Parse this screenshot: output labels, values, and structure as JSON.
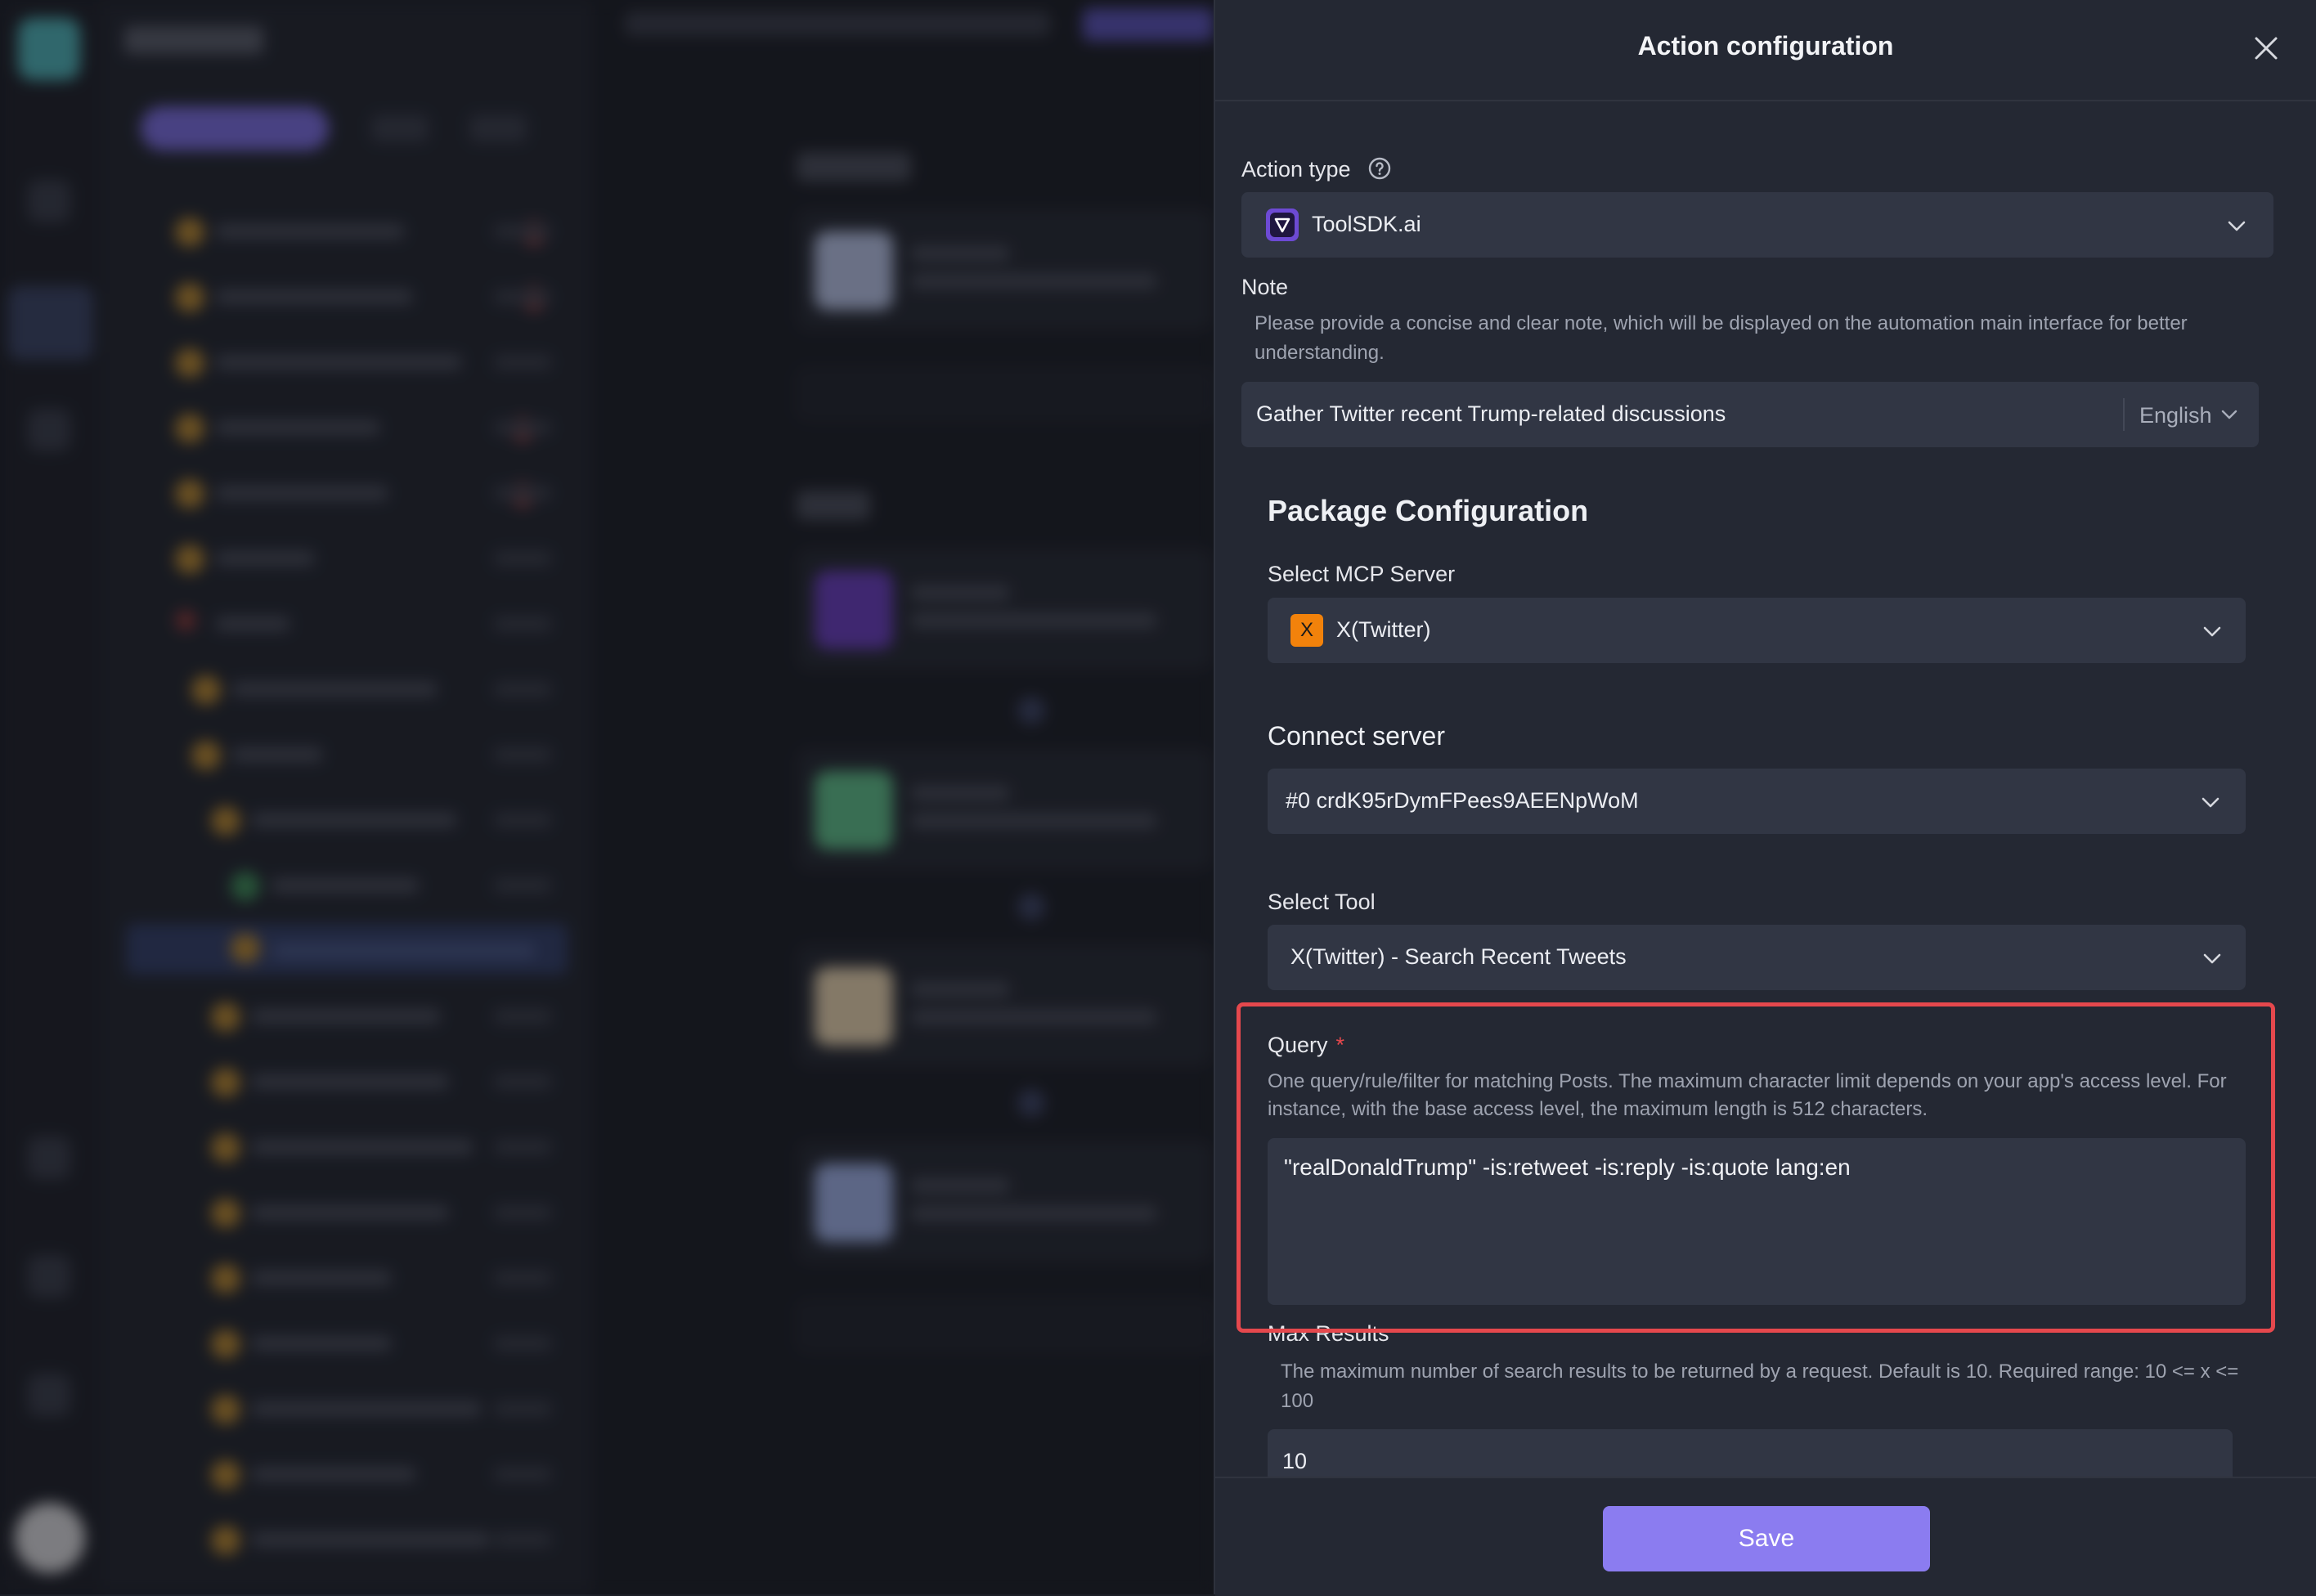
{
  "drawer": {
    "title": "Action configuration",
    "action_type": {
      "label": "Action type",
      "value": "ToolSDK.ai"
    },
    "note": {
      "label": "Note",
      "description": "Please provide a concise and clear note, which will be displayed on the automation main interface for better understanding.",
      "value": "Gather Twitter recent Trump-related discussions",
      "language": "English"
    },
    "package": {
      "heading": "Package Configuration",
      "mcp_server": {
        "label": "Select MCP Server",
        "value": "X(Twitter)",
        "badge": "X"
      },
      "connect_server": {
        "label": "Connect server",
        "value": "#0 crdK95rDymFPees9AEENpWoM"
      },
      "tool": {
        "label": "Select Tool",
        "value": "X(Twitter) - Search Recent Tweets"
      },
      "query": {
        "label": "Query",
        "required_mark": "*",
        "description": "One query/rule/filter for matching Posts. The maximum character limit depends on your app's access level. For instance, with the base access level, the maximum length is 512 characters.",
        "value": "\"realDonaldTrump\" -is:retweet -is:reply -is:quote lang:en"
      },
      "max_results": {
        "label": "Max Results",
        "description": "The maximum number of search results to be returned by a request. Default is 10. Required range: 10 <= x <= 100",
        "value": "10"
      }
    },
    "save_label": "Save"
  },
  "colors": {
    "highlight": "#e5484d",
    "save_button": "#8b7cf0",
    "x_badge": "#f2820b",
    "tool_badge": "#6d4ad4"
  },
  "icons": [
    "close-icon",
    "help-icon",
    "chevron-down-icon",
    "toolsdk-logo-icon",
    "x-badge-icon"
  ]
}
